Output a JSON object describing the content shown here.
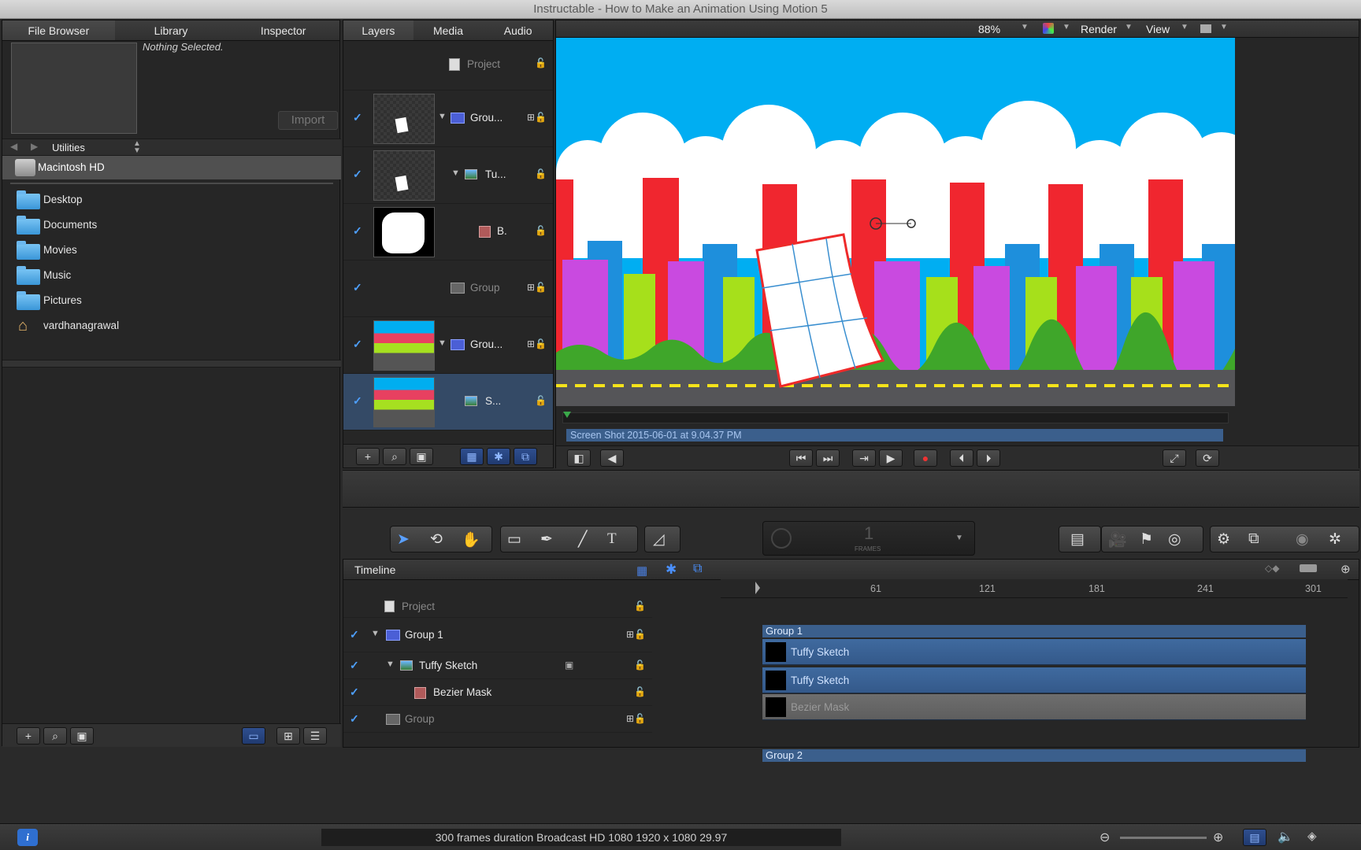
{
  "window": {
    "title": "Instructable - How to Make an Animation Using Motion 5"
  },
  "browser": {
    "tabs": [
      "File Browser",
      "Library",
      "Inspector"
    ],
    "selected_tab": "File Browser",
    "preview_text": "Nothing Selected.",
    "import_label": "Import",
    "location": "Utilities",
    "drive": "Macintosh HD",
    "items": [
      {
        "label": "Desktop",
        "icon": "folder-icon"
      },
      {
        "label": "Documents",
        "icon": "folder-icon"
      },
      {
        "label": "Movies",
        "icon": "folder-icon"
      },
      {
        "label": "Music",
        "icon": "folder-icon"
      },
      {
        "label": "Pictures",
        "icon": "folder-icon"
      },
      {
        "label": "vardhanagrawal",
        "icon": "home-icon"
      }
    ]
  },
  "layers": {
    "tabs": [
      "Layers",
      "Media",
      "Audio"
    ],
    "selected_tab": "Layers",
    "rows": [
      {
        "name": "Project",
        "checked": false
      },
      {
        "name": "Grou...",
        "checked": true
      },
      {
        "name": "Tu...",
        "checked": true
      },
      {
        "name": "B.",
        "checked": true
      },
      {
        "name": "Group",
        "checked": true
      },
      {
        "name": "Grou...",
        "checked": true
      },
      {
        "name": "S...",
        "checked": true
      }
    ]
  },
  "canvas": {
    "zoom": "88%",
    "render_label": "Render",
    "view_label": "View",
    "clip_label": "Screen Shot 2015-06-01 at 9.04.37 PM"
  },
  "toolbar": {
    "frame_value": "1",
    "frame_unit": "FRAMES"
  },
  "timeline": {
    "title": "Timeline",
    "ruler": [
      "61",
      "121",
      "181",
      "241",
      "301"
    ],
    "rows": [
      {
        "name": "Project",
        "checked": false
      },
      {
        "name": "Group 1",
        "checked": true
      },
      {
        "name": "Tuffy Sketch",
        "checked": true
      },
      {
        "name": "Bezier Mask",
        "checked": true
      },
      {
        "name": "Group",
        "checked": true
      },
      {
        "name": "Group 2",
        "checked": true
      },
      {
        "name": "Screen Shot 2015-06-01 at 9.04.37 PM",
        "checked": true
      }
    ],
    "size_label": "Small",
    "tracks": {
      "group1": "Group 1",
      "tuffy1": "Tuffy Sketch",
      "tuffy2": "Tuffy Sketch",
      "bezier": "Bezier Mask",
      "group2": "Group 2",
      "shot1": "Screen Shot 2015-06-01 at 9.04.37 PM",
      "shot2": "Screen Shot 2015-06-01 at 9.04.37 PM"
    }
  },
  "status": {
    "text": "300 frames duration Broadcast HD 1080 1920 x 1080 29.97"
  }
}
